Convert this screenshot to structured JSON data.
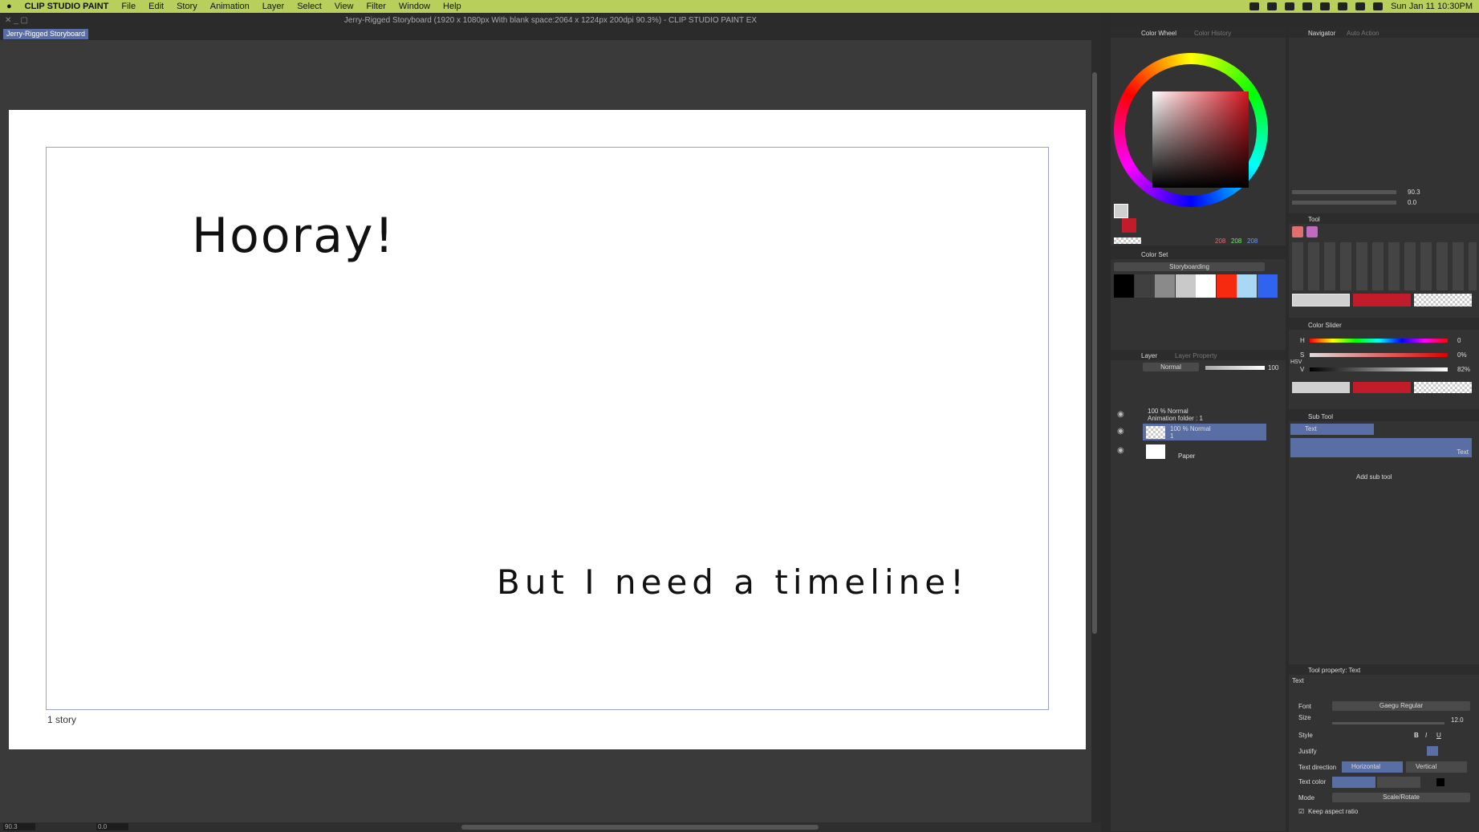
{
  "menubar": {
    "apple": "",
    "app": "CLIP STUDIO PAINT",
    "items": [
      "File",
      "Edit",
      "Story",
      "Animation",
      "Layer",
      "Select",
      "View",
      "Filter",
      "Window",
      "Help"
    ],
    "clock": "Sun Jan 11  10:30PM"
  },
  "window": {
    "title": "Jerry-Rigged Storyboard (1920 x 1080px With blank space:2064 x 1224px 200dpi 90.3%)  - CLIP STUDIO PAINT EX",
    "doc_tab": "Jerry-Rigged Storyboard"
  },
  "canvas": {
    "text1": "Hooray!",
    "text2": "But I need a timeline!",
    "story_label": "1 story"
  },
  "bottombar": {
    "zoom": "90.3",
    "angle": "0.0"
  },
  "color_wheel": {
    "tab1": "Color Wheel",
    "tab2": "Color History",
    "r": "208",
    "g": "208",
    "b": "208",
    "main_color": "#d0d0d0",
    "sub_color": "#c21c2a"
  },
  "color_set": {
    "title": "Color Set",
    "set_name": "Storyboarding",
    "swatches": [
      "#000000",
      "#404040",
      "#8a8a8a",
      "#c9c9c9",
      "#ffffff",
      "#f52a0e",
      "#a8d8f4",
      "#2f63f0"
    ]
  },
  "layer": {
    "tab1": "Layer",
    "tab2": "Layer Property",
    "blend": "Normal",
    "opacity": "100",
    "rows": [
      {
        "l1": "100 % Normal",
        "l2": "Animation folder : 1"
      },
      {
        "l1": "100 % Normal",
        "l2": "1"
      },
      {
        "l1": "",
        "l2": "Paper"
      }
    ]
  },
  "navigator": {
    "tab1": "Navigator",
    "tab2": "Auto Action",
    "zoom": "90.3",
    "rotate": "0.0"
  },
  "tool": {
    "title": "Tool"
  },
  "color_slider": {
    "title": "Color Slider",
    "h_label": "H",
    "s_label": "S",
    "v_label": "V",
    "h": "0",
    "s": "0%",
    "v": "82%",
    "mode": "HSV"
  },
  "sub_tool": {
    "title": "Sub Tool",
    "group": "Text",
    "item": "Text",
    "item_label": "Text",
    "add": "Add sub tool"
  },
  "tool_property": {
    "title": "Tool property: Text",
    "name": "Text",
    "font_label": "Font",
    "font": "Gaegu Regular",
    "size_label": "Size",
    "size": "12.0",
    "style_label": "Style",
    "justify_label": "Justify",
    "dir_label": "Text direction",
    "dir_h": "Horizontal",
    "dir_v": "Vertical",
    "color_label": "Text color",
    "mode_label": "Mode",
    "mode": "Scale/Rotate",
    "keep": "Keep aspect ratio"
  }
}
